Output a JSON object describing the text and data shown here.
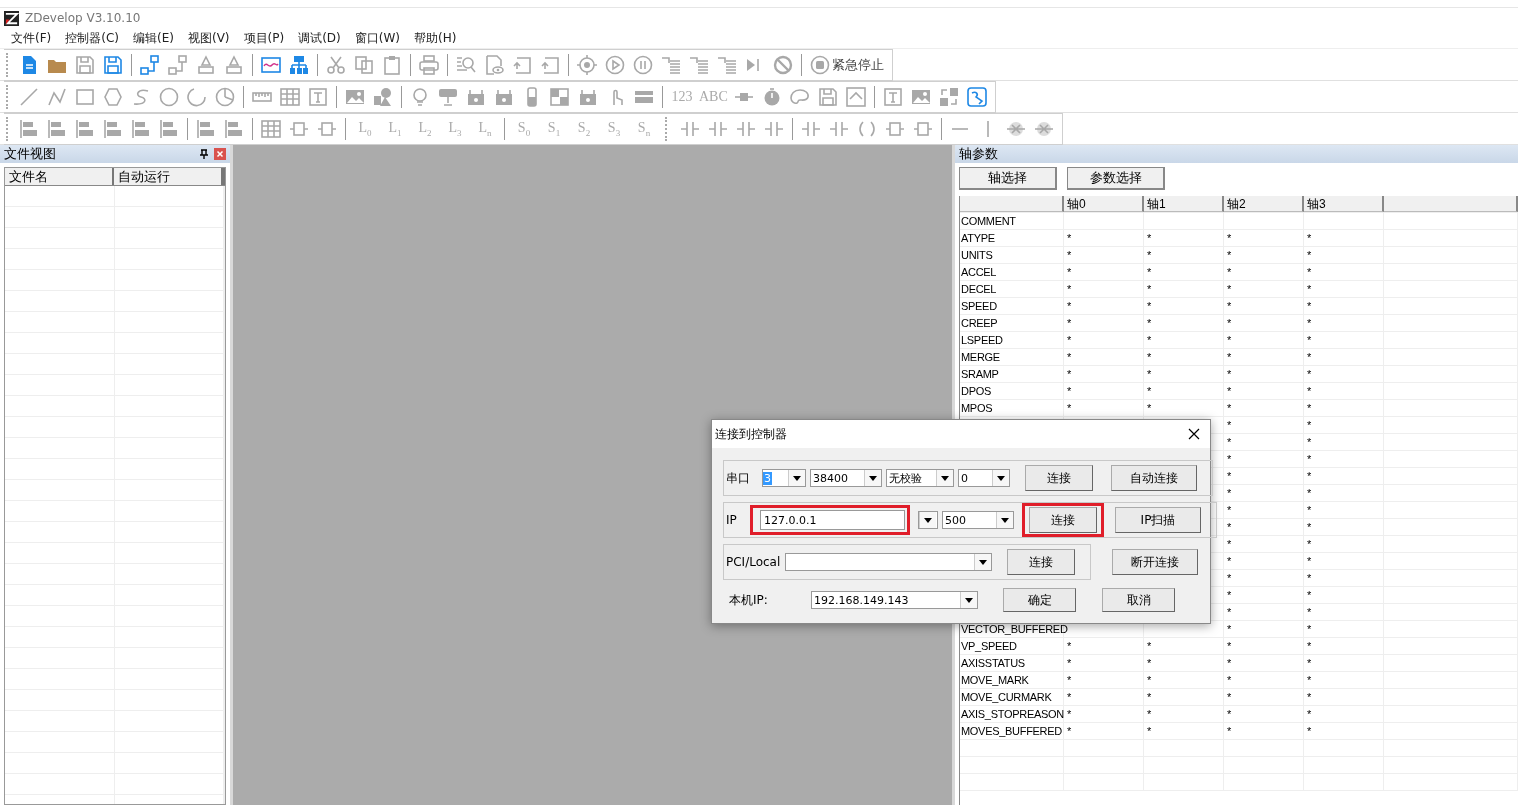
{
  "window": {
    "title": "ZDevelop V3.10.10"
  },
  "menu": [
    "文件(F)",
    "控制器(C)",
    "编辑(E)",
    "视图(V)",
    "项目(P)",
    "调试(D)",
    "窗口(W)",
    "帮助(H)"
  ],
  "toolbars": [
    {
      "items": [
        {
          "kind": "icon",
          "disabled": false
        },
        {
          "kind": "icon",
          "disabled": false
        },
        {
          "kind": "icon",
          "disabled": true
        },
        {
          "kind": "icon",
          "disabled": false
        },
        {
          "kind": "sep"
        },
        {
          "kind": "icon",
          "disabled": false
        },
        {
          "kind": "icon",
          "disabled": true
        },
        {
          "kind": "icon",
          "disabled": true
        },
        {
          "kind": "icon",
          "disabled": true
        },
        {
          "kind": "sep"
        },
        {
          "kind": "icon",
          "disabled": false
        },
        {
          "kind": "icon",
          "disabled": false
        },
        {
          "kind": "sep"
        },
        {
          "kind": "icon",
          "disabled": true
        },
        {
          "kind": "icon",
          "disabled": true
        },
        {
          "kind": "icon",
          "disabled": true
        },
        {
          "kind": "sep"
        },
        {
          "kind": "icon",
          "disabled": true
        },
        {
          "kind": "sep"
        },
        {
          "kind": "icon",
          "disabled": true
        },
        {
          "kind": "icon",
          "disabled": true
        },
        {
          "kind": "icon",
          "disabled": true
        },
        {
          "kind": "icon",
          "disabled": true
        },
        {
          "kind": "sep"
        },
        {
          "kind": "icon",
          "disabled": true
        },
        {
          "kind": "icon",
          "disabled": true
        },
        {
          "kind": "icon",
          "disabled": true
        },
        {
          "kind": "icon",
          "disabled": true
        },
        {
          "kind": "icon",
          "disabled": true
        },
        {
          "kind": "icon",
          "disabled": true
        },
        {
          "kind": "icon",
          "disabled": true
        },
        {
          "kind": "icon",
          "disabled": true
        },
        {
          "kind": "sep"
        },
        {
          "kind": "button",
          "text": "紧急停止"
        }
      ]
    },
    {
      "items": [
        {
          "kind": "icon",
          "disabled": true
        },
        {
          "kind": "icon",
          "disabled": true
        },
        {
          "kind": "icon",
          "disabled": true
        },
        {
          "kind": "icon",
          "disabled": true
        },
        {
          "kind": "icon",
          "disabled": true
        },
        {
          "kind": "icon",
          "disabled": true
        },
        {
          "kind": "icon",
          "disabled": true
        },
        {
          "kind": "icon",
          "disabled": true
        },
        {
          "kind": "sep"
        },
        {
          "kind": "icon",
          "disabled": true
        },
        {
          "kind": "icon",
          "disabled": true
        },
        {
          "kind": "icon",
          "disabled": true
        },
        {
          "kind": "sep"
        },
        {
          "kind": "icon",
          "disabled": true
        },
        {
          "kind": "icon",
          "disabled": true
        },
        {
          "kind": "sep"
        },
        {
          "kind": "icon",
          "disabled": true
        },
        {
          "kind": "icon",
          "disabled": true
        },
        {
          "kind": "icon",
          "disabled": true
        },
        {
          "kind": "icon",
          "disabled": true
        },
        {
          "kind": "icon",
          "disabled": true
        },
        {
          "kind": "icon",
          "disabled": true
        },
        {
          "kind": "icon",
          "disabled": true
        },
        {
          "kind": "icon",
          "disabled": true
        },
        {
          "kind": "icon",
          "disabled": true
        },
        {
          "kind": "sep"
        },
        {
          "kind": "label",
          "text": "123",
          "disabled": true
        },
        {
          "kind": "label",
          "text": "ABC",
          "disabled": true
        },
        {
          "kind": "icon",
          "disabled": true
        },
        {
          "kind": "icon",
          "disabled": true
        },
        {
          "kind": "icon",
          "disabled": true
        },
        {
          "kind": "icon",
          "disabled": true
        },
        {
          "kind": "icon",
          "disabled": true
        },
        {
          "kind": "sep"
        },
        {
          "kind": "icon",
          "disabled": true
        },
        {
          "kind": "icon",
          "disabled": true
        },
        {
          "kind": "icon",
          "disabled": true
        },
        {
          "kind": "icon",
          "disabled": false
        }
      ]
    },
    {
      "items": [
        {
          "kind": "icon",
          "disabled": true
        },
        {
          "kind": "icon",
          "disabled": true
        },
        {
          "kind": "icon",
          "disabled": true
        },
        {
          "kind": "icon",
          "disabled": true
        },
        {
          "kind": "icon",
          "disabled": true
        },
        {
          "kind": "icon",
          "disabled": true
        },
        {
          "kind": "sep"
        },
        {
          "kind": "icon",
          "disabled": true
        },
        {
          "kind": "icon",
          "disabled": true
        },
        {
          "kind": "sep"
        },
        {
          "kind": "icon",
          "disabled": true
        },
        {
          "kind": "icon",
          "disabled": true
        },
        {
          "kind": "icon",
          "disabled": true
        },
        {
          "kind": "sep"
        },
        {
          "kind": "label",
          "text": "L$_{0}$",
          "disabled": true
        },
        {
          "kind": "label",
          "text": "L$_{1}$",
          "disabled": true
        },
        {
          "kind": "label",
          "text": "L$_{2}$",
          "disabled": true
        },
        {
          "kind": "label",
          "text": "L$_{3}$",
          "disabled": true
        },
        {
          "kind": "label",
          "text": "L$_{n}$",
          "disabled": true
        },
        {
          "kind": "sep"
        },
        {
          "kind": "label",
          "text": "S$_{0}$",
          "disabled": true
        },
        {
          "kind": "label",
          "text": "S$_{1}$",
          "disabled": true
        },
        {
          "kind": "label",
          "text": "S$_{2}$",
          "disabled": true
        },
        {
          "kind": "label",
          "text": "S$_{3}$",
          "disabled": true
        },
        {
          "kind": "label",
          "text": "S$_{n}$",
          "disabled": true
        },
        {
          "kind": "grip"
        },
        {
          "kind": "icon",
          "disabled": true
        },
        {
          "kind": "icon",
          "disabled": true
        },
        {
          "kind": "icon",
          "disabled": true
        },
        {
          "kind": "icon",
          "disabled": true
        },
        {
          "kind": "sep"
        },
        {
          "kind": "icon",
          "disabled": true
        },
        {
          "kind": "icon",
          "disabled": true
        },
        {
          "kind": "icon",
          "disabled": true
        },
        {
          "kind": "icon",
          "disabled": true
        },
        {
          "kind": "icon",
          "disabled": true
        },
        {
          "kind": "sep"
        },
        {
          "kind": "icon",
          "disabled": true
        },
        {
          "kind": "icon",
          "disabled": true
        },
        {
          "kind": "icon",
          "disabled": true
        },
        {
          "kind": "icon",
          "disabled": true
        }
      ]
    }
  ],
  "file_view": {
    "title": "文件视图",
    "columns": [
      "文件名",
      "自动运行"
    ]
  },
  "axis_params": {
    "title": "轴参数",
    "buttons": [
      "轴选择",
      "参数选择"
    ],
    "columns": [
      "轴0",
      "轴1",
      "轴2",
      "轴3"
    ],
    "rows": [
      {
        "name": "COMMENT"
      },
      {
        "name": "ATYPE",
        "cells": [
          "*",
          "*",
          "*",
          "*"
        ]
      },
      {
        "name": "UNITS",
        "cells": [
          "*",
          "*",
          "*",
          "*"
        ]
      },
      {
        "name": "ACCEL",
        "cells": [
          "*",
          "*",
          "*",
          "*"
        ]
      },
      {
        "name": "DECEL",
        "cells": [
          "*",
          "*",
          "*",
          "*"
        ]
      },
      {
        "name": "SPEED",
        "cells": [
          "*",
          "*",
          "*",
          "*"
        ]
      },
      {
        "name": "CREEP",
        "cells": [
          "*",
          "*",
          "*",
          "*"
        ]
      },
      {
        "name": "LSPEED",
        "cells": [
          "*",
          "*",
          "*",
          "*"
        ]
      },
      {
        "name": "MERGE",
        "cells": [
          "*",
          "*",
          "*",
          "*"
        ]
      },
      {
        "name": "SRAMP",
        "cells": [
          "*",
          "*",
          "*",
          "*"
        ]
      },
      {
        "name": "DPOS",
        "cells": [
          "*",
          "*",
          "*",
          "*"
        ]
      },
      {
        "name": "MPOS",
        "cells": [
          "*",
          "*",
          "*",
          "*"
        ]
      },
      {
        "cells": [
          null,
          null,
          "*",
          "*"
        ]
      },
      {
        "cells": [
          null,
          null,
          "*",
          "*"
        ]
      },
      {
        "cells": [
          null,
          null,
          "*",
          "*"
        ]
      },
      {
        "cells": [
          null,
          null,
          "*",
          "*"
        ]
      },
      {
        "cells": [
          null,
          null,
          "*",
          "*"
        ]
      },
      {
        "cells": [
          null,
          null,
          "*",
          "*"
        ]
      },
      {
        "cells": [
          null,
          null,
          "*",
          "*"
        ]
      },
      {
        "cells": [
          null,
          null,
          "*",
          "*"
        ]
      },
      {
        "cells": [
          null,
          null,
          "*",
          "*"
        ]
      },
      {
        "cells": [
          null,
          null,
          "*",
          "*"
        ]
      },
      {
        "cells": [
          null,
          null,
          "*",
          "*"
        ]
      },
      {
        "cells": [
          null,
          null,
          "*",
          "*"
        ]
      },
      {
        "name": "VECTOR_BUFFERED",
        "cells": [
          null,
          null,
          "*",
          "*"
        ]
      },
      {
        "name": "VP_SPEED",
        "cells": [
          "*",
          "*",
          "*",
          "*"
        ]
      },
      {
        "name": "AXISSTATUS",
        "cells": [
          "*",
          "*",
          "*",
          "*"
        ]
      },
      {
        "name": "MOVE_MARK",
        "cells": [
          "*",
          "*",
          "*",
          "*"
        ]
      },
      {
        "name": "MOVE_CURMARK",
        "cells": [
          "*",
          "*",
          "*",
          "*"
        ]
      },
      {
        "name": "AXIS_STOPREASON",
        "cells": [
          "*",
          "*",
          "*",
          "*"
        ]
      },
      {
        "name": "MOVES_BUFFERED",
        "cells": [
          "*",
          "*",
          "*",
          "*"
        ]
      }
    ]
  },
  "dialog": {
    "title": "连接到控制器",
    "serial": {
      "label": "串口",
      "port": "3",
      "port_text_selected": true,
      "baud": "38400",
      "parity": "无校验",
      "extra": "0",
      "buttons": [
        {
          "label": "连接",
          "highlighted": false
        },
        {
          "label": "自动连接",
          "highlighted": false
        }
      ]
    },
    "ip": {
      "label": "IP",
      "address": "127.0.0.1",
      "address_highlighted": true,
      "timeout": "500",
      "buttons": [
        {
          "label": "连接",
          "highlighted": true
        },
        {
          "label": "IP扫描",
          "highlighted": false
        }
      ]
    },
    "pci": {
      "label": "PCI/Local",
      "buttons": [
        {
          "label": "连接",
          "highlighted": false
        },
        {
          "label": "断开连接",
          "highlighted": false
        }
      ]
    },
    "local_ip": {
      "label": "本机IP:",
      "value": "192.168.149.143"
    },
    "buttons": [
      {
        "label": "确定",
        "highlighted": false
      },
      {
        "label": "取消",
        "highlighted": false
      }
    ]
  }
}
